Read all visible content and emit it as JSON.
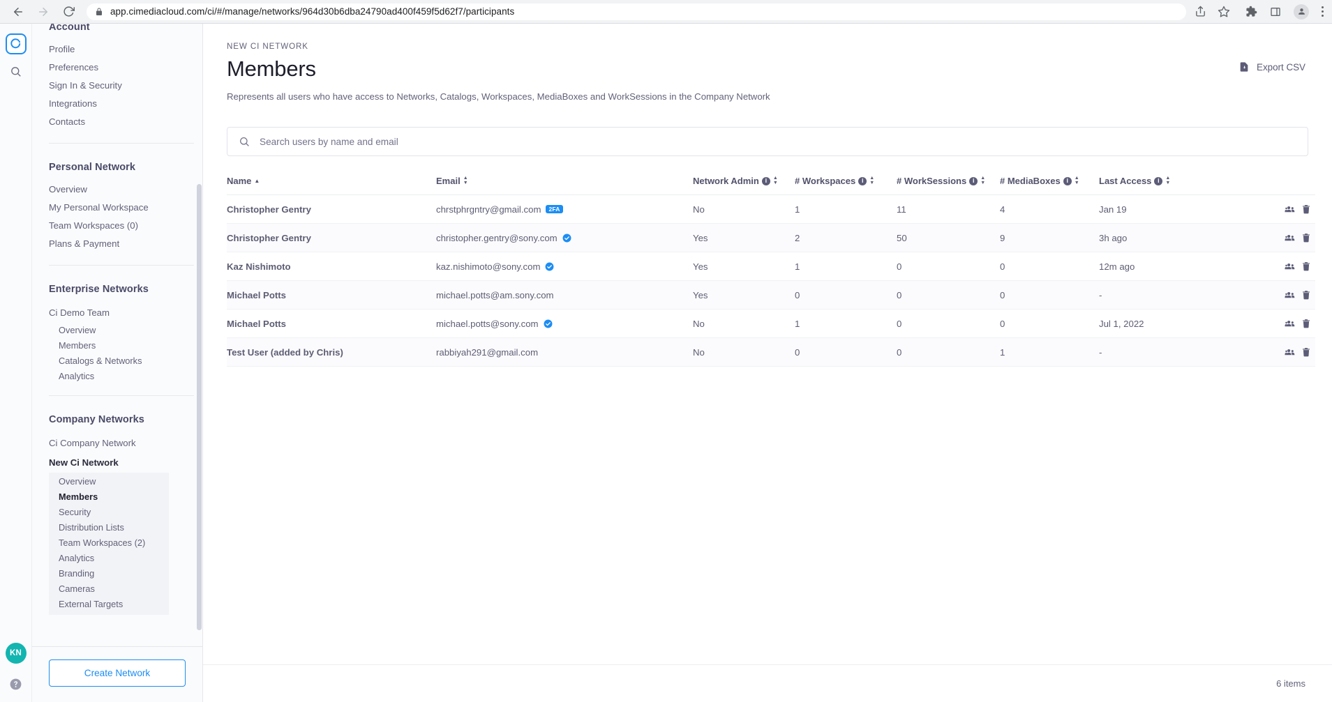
{
  "browser": {
    "url": "app.cimediacloud.com/ci/#/manage/networks/964d30b6dba24790ad400f459f5d62f7/participants",
    "back_label": "Back",
    "forward_label": "Forward",
    "reload_label": "Reload",
    "share_label": "Share this page",
    "bookmark_label": "Bookmark this tab",
    "extensions_label": "Extensions",
    "sidepanel_label": "Side panel",
    "profile_label": "Profile",
    "menu_label": "Customize and control Chrome"
  },
  "rail": {
    "logo_label": "Ci",
    "search_label": "Search",
    "avatar_initials": "KN",
    "help_label": "Help"
  },
  "sidebar": {
    "groups": [
      {
        "title": "Account",
        "links": [
          {
            "label": "Profile"
          },
          {
            "label": "Preferences"
          },
          {
            "label": "Sign In & Security"
          },
          {
            "label": "Integrations"
          },
          {
            "label": "Contacts"
          }
        ]
      },
      {
        "title": "Personal Network",
        "links": [
          {
            "label": "Overview"
          },
          {
            "label": "My Personal Workspace"
          },
          {
            "label": "Team Workspaces (0)"
          },
          {
            "label": "Plans & Payment"
          }
        ]
      },
      {
        "title": "Enterprise Networks",
        "networks": [
          {
            "label": "Ci Demo Team",
            "active": false,
            "sub": [
              {
                "label": "Overview",
                "active": false
              },
              {
                "label": "Members",
                "active": false
              },
              {
                "label": "Catalogs & Networks",
                "active": false
              },
              {
                "label": "Analytics",
                "active": false
              }
            ]
          }
        ]
      },
      {
        "title": "Company Networks",
        "networks": [
          {
            "label": "Ci Company Network",
            "active": false,
            "sub": []
          },
          {
            "label": "New Ci Network",
            "active": true,
            "sub": [
              {
                "label": "Overview",
                "active": false
              },
              {
                "label": "Members",
                "active": true
              },
              {
                "label": "Security",
                "active": false
              },
              {
                "label": "Distribution Lists",
                "active": false
              },
              {
                "label": "Team Workspaces (2)",
                "active": false
              },
              {
                "label": "Analytics",
                "active": false
              },
              {
                "label": "Branding",
                "active": false
              },
              {
                "label": "Cameras",
                "active": false
              },
              {
                "label": "External Targets",
                "active": false
              }
            ]
          }
        ]
      }
    ],
    "create_network_label": "Create Network"
  },
  "page": {
    "eyebrow": "NEW CI NETWORK",
    "title": "Members",
    "subtitle": "Represents all users who have access to Networks, Catalogs, Workspaces, MediaBoxes and WorkSessions in the Company Network",
    "export_label": "Export CSV"
  },
  "search": {
    "placeholder": "Search users by name and email",
    "value": ""
  },
  "table": {
    "columns": [
      {
        "label": "Name",
        "info": false,
        "sorted": "asc"
      },
      {
        "label": "Email",
        "info": false,
        "sorted": "none"
      },
      {
        "label": "Network Admin",
        "info": true,
        "sorted": "none"
      },
      {
        "label": "# Workspaces",
        "info": true,
        "sorted": "none"
      },
      {
        "label": "# WorkSessions",
        "info": true,
        "sorted": "none"
      },
      {
        "label": "# MediaBoxes",
        "info": true,
        "sorted": "none"
      },
      {
        "label": "Last Access",
        "info": true,
        "sorted": "none"
      },
      {
        "label": "",
        "info": false,
        "sorted": "none"
      }
    ],
    "rows": [
      {
        "name": "Christopher Gentry",
        "email": "chrstphrgntry@gmail.com",
        "badge": "2FA",
        "verified": false,
        "network_admin": "No",
        "workspaces": "1",
        "worksessions": "11",
        "mediaboxes": "4",
        "last_access": "Jan 19"
      },
      {
        "name": "Christopher Gentry",
        "email": "christopher.gentry@sony.com",
        "badge": "",
        "verified": true,
        "network_admin": "Yes",
        "workspaces": "2",
        "worksessions": "50",
        "mediaboxes": "9",
        "last_access": "3h ago"
      },
      {
        "name": "Kaz Nishimoto",
        "email": "kaz.nishimoto@sony.com",
        "badge": "",
        "verified": true,
        "network_admin": "Yes",
        "workspaces": "1",
        "worksessions": "0",
        "mediaboxes": "0",
        "last_access": "12m ago"
      },
      {
        "name": "Michael Potts",
        "email": "michael.potts@am.sony.com",
        "badge": "",
        "verified": false,
        "network_admin": "Yes",
        "workspaces": "0",
        "worksessions": "0",
        "mediaboxes": "0",
        "last_access": "-"
      },
      {
        "name": "Michael Potts",
        "email": "michael.potts@sony.com",
        "badge": "",
        "verified": true,
        "network_admin": "No",
        "workspaces": "1",
        "worksessions": "0",
        "mediaboxes": "0",
        "last_access": "Jul 1, 2022"
      },
      {
        "name": "Test User (added by Chris)",
        "email": "rabbiyah291@gmail.com",
        "badge": "",
        "verified": false,
        "network_admin": "No",
        "workspaces": "0",
        "worksessions": "0",
        "mediaboxes": "1",
        "last_access": "-"
      }
    ],
    "row_actions": {
      "manage_label": "Manage groups",
      "delete_label": "Remove member"
    }
  },
  "footer": {
    "item_count": "6 items"
  },
  "colors": {
    "accent_blue": "#1c8df4",
    "avatar_teal": "#12b5b0",
    "text_primary": "#1d1d2b",
    "text_muted": "#62627a",
    "badge_blue": "#1c8df4"
  }
}
